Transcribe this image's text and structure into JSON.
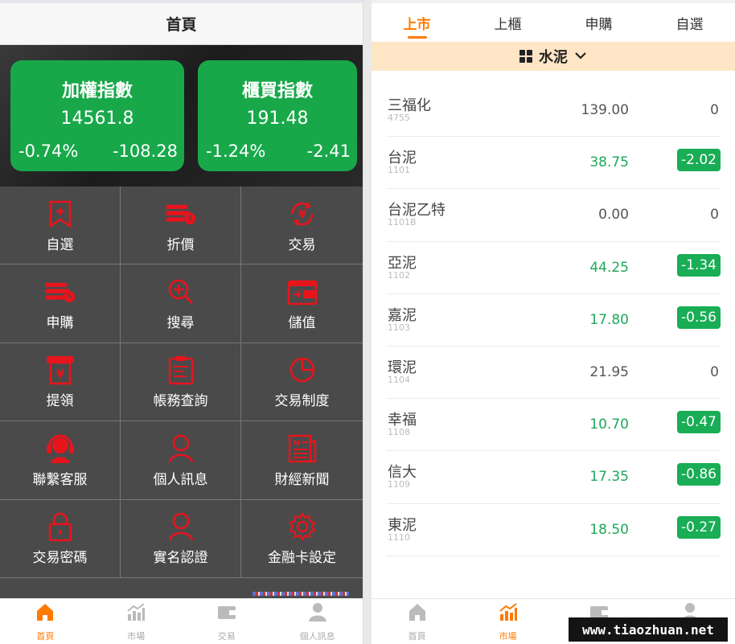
{
  "left": {
    "header_title": "首頁",
    "cards": [
      {
        "title": "加權指數",
        "value": "14561.8",
        "pct": "-0.74%",
        "diff": "-108.28"
      },
      {
        "title": "櫃買指數",
        "value": "191.48",
        "pct": "-1.24%",
        "diff": "-2.41"
      }
    ],
    "menu": [
      {
        "label": "自選",
        "icon": "bookmark-icon"
      },
      {
        "label": "折價",
        "icon": "discount-icon"
      },
      {
        "label": "交易",
        "icon": "yen-cycle-icon"
      },
      {
        "label": "申購",
        "icon": "subscribe-icon"
      },
      {
        "label": "搜尋",
        "icon": "search-icon"
      },
      {
        "label": "儲值",
        "icon": "wallet-icon"
      },
      {
        "label": "提領",
        "icon": "atm-withdraw-icon"
      },
      {
        "label": "帳務查詢",
        "icon": "ledger-icon"
      },
      {
        "label": "交易制度",
        "icon": "pie-chart-icon"
      },
      {
        "label": "聯繫客服",
        "icon": "headset-icon"
      },
      {
        "label": "個人訊息",
        "icon": "user-icon"
      },
      {
        "label": "財經新聞",
        "icon": "newspaper-icon"
      },
      {
        "label": "交易密碼",
        "icon": "lock-icon"
      },
      {
        "label": "實名認證",
        "icon": "user-verify-icon"
      },
      {
        "label": "金融卡設定",
        "icon": "gear-icon"
      }
    ],
    "tabbar": [
      {
        "label": "首頁",
        "icon": "home-icon",
        "active": true
      },
      {
        "label": "市場",
        "icon": "market-chart-icon",
        "active": false
      },
      {
        "label": "交易",
        "icon": "wallet-icon",
        "active": false
      },
      {
        "label": "個人訊息",
        "icon": "user-icon",
        "active": false
      }
    ]
  },
  "right": {
    "tabs": [
      {
        "label": "上市",
        "active": true
      },
      {
        "label": "上櫃",
        "active": false
      },
      {
        "label": "申購",
        "active": false
      },
      {
        "label": "自選",
        "active": false
      }
    ],
    "category": "水泥",
    "stocks": [
      {
        "name": "三福化",
        "code": "4755",
        "price": "139.00",
        "change": "0",
        "up": false,
        "badge": false
      },
      {
        "name": "台泥",
        "code": "1101",
        "price": "38.75",
        "change": "-2.02",
        "up": true,
        "badge": true
      },
      {
        "name": "台泥乙特",
        "code": "1101B",
        "price": "0.00",
        "change": "0",
        "up": false,
        "badge": false
      },
      {
        "name": "亞泥",
        "code": "1102",
        "price": "44.25",
        "change": "-1.34",
        "up": true,
        "badge": true
      },
      {
        "name": "嘉泥",
        "code": "1103",
        "price": "17.80",
        "change": "-0.56",
        "up": true,
        "badge": true
      },
      {
        "name": "環泥",
        "code": "1104",
        "price": "21.95",
        "change": "0",
        "up": false,
        "badge": false
      },
      {
        "name": "幸福",
        "code": "1108",
        "price": "10.70",
        "change": "-0.47",
        "up": true,
        "badge": true
      },
      {
        "name": "信大",
        "code": "1109",
        "price": "17.35",
        "change": "-0.86",
        "up": true,
        "badge": true
      },
      {
        "name": "東泥",
        "code": "1110",
        "price": "18.50",
        "change": "-0.27",
        "up": true,
        "badge": true
      }
    ],
    "tabbar": [
      {
        "label": "首頁",
        "icon": "home-icon",
        "active": false
      },
      {
        "label": "市場",
        "icon": "market-chart-icon",
        "active": true
      },
      {
        "label": "交易",
        "icon": "wallet-icon",
        "active": false
      },
      {
        "label": "個人訊息",
        "icon": "user-icon",
        "active": false
      }
    ],
    "watermark": "www.tiaozhuan.net"
  },
  "colors": {
    "accent": "#ff7a00",
    "green": "#19ad55",
    "icon_red": "#e8141c",
    "grid_bg": "#4a4a4a"
  }
}
